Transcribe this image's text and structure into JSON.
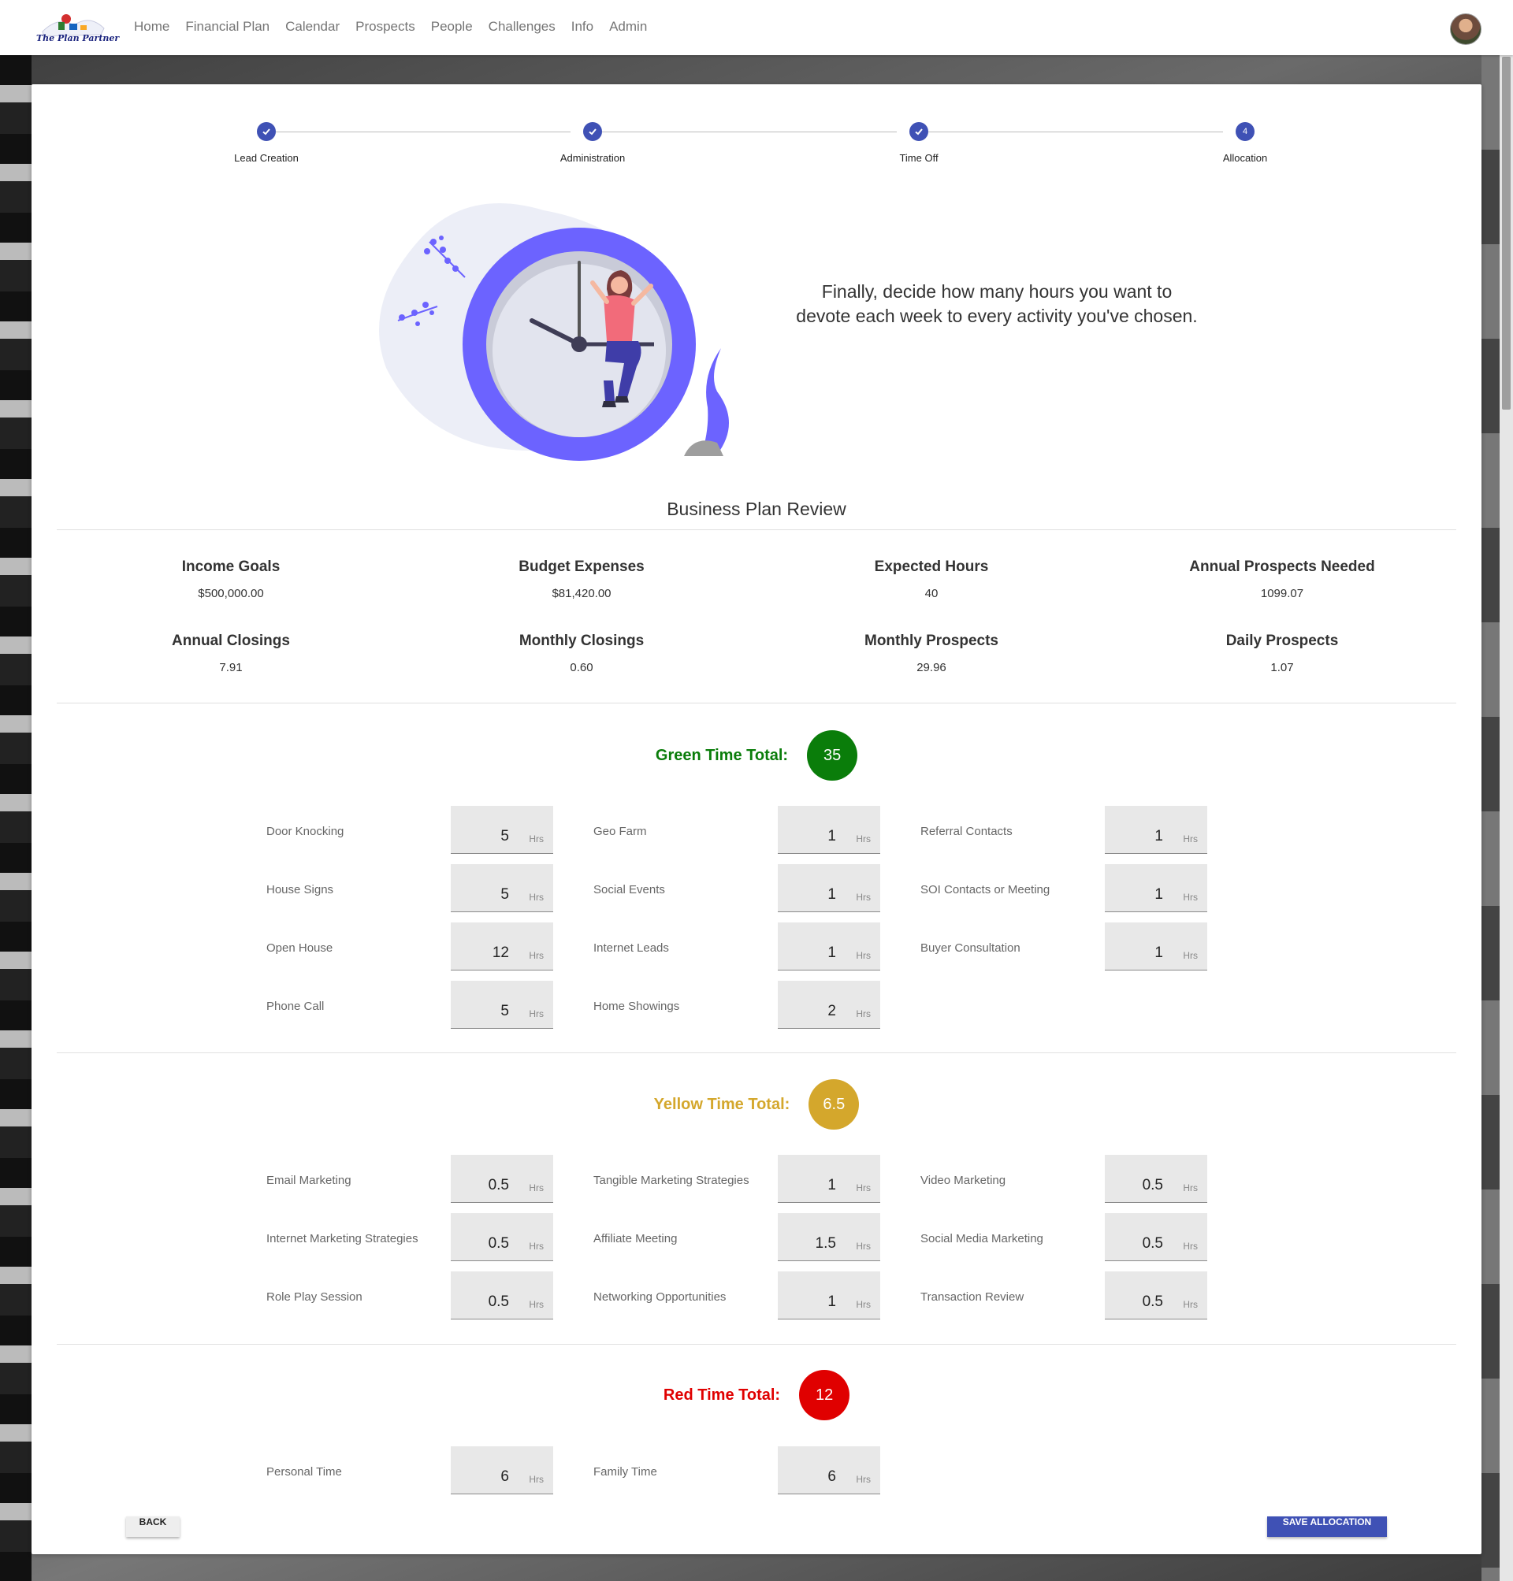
{
  "app": {
    "logo_text": "The Plan Partner",
    "nav": [
      "Home",
      "Financial Plan",
      "Calendar",
      "Prospects",
      "People",
      "Challenges",
      "Info",
      "Admin"
    ]
  },
  "stepper": {
    "steps": [
      {
        "label": "Lead Creation",
        "state": "done"
      },
      {
        "label": "Administration",
        "state": "done"
      },
      {
        "label": "Time Off",
        "state": "done"
      },
      {
        "label": "Allocation",
        "state": "active",
        "number": "4"
      }
    ]
  },
  "hero": {
    "line1": "Finally, decide how many hours you want to",
    "line2": "devote each week to every activity you've chosen."
  },
  "review": {
    "title": "Business Plan Review",
    "stats": [
      {
        "label": "Income Goals",
        "value": "$500,000.00"
      },
      {
        "label": "Budget Expenses",
        "value": "$81,420.00"
      },
      {
        "label": "Expected Hours",
        "value": "40"
      },
      {
        "label": "Annual Prospects Needed",
        "value": "1099.07"
      },
      {
        "label": "Annual Closings",
        "value": "7.91"
      },
      {
        "label": "Monthly Closings",
        "value": "0.60"
      },
      {
        "label": "Monthly Prospects",
        "value": "29.96"
      },
      {
        "label": "Daily Prospects",
        "value": "1.07"
      }
    ]
  },
  "unit": "Hrs",
  "green": {
    "title": "Green Time Total:",
    "total": "35",
    "color": "#0a7d0a",
    "items": [
      {
        "label": "Door Knocking",
        "value": "5"
      },
      {
        "label": "Geo Farm",
        "value": "1"
      },
      {
        "label": "Referral Contacts",
        "value": "1"
      },
      {
        "label": "House Signs",
        "value": "5"
      },
      {
        "label": "Social Events",
        "value": "1"
      },
      {
        "label": "SOI Contacts or Meeting",
        "value": "1"
      },
      {
        "label": "Open House",
        "value": "12"
      },
      {
        "label": "Internet Leads",
        "value": "1"
      },
      {
        "label": "Buyer Consultation",
        "value": "1"
      },
      {
        "label": "Phone Call",
        "value": "5"
      },
      {
        "label": "Home Showings",
        "value": "2"
      }
    ]
  },
  "yellow": {
    "title": "Yellow Time Total:",
    "total": "6.5",
    "color": "#d4a72c",
    "items": [
      {
        "label": "Email Marketing",
        "value": "0.5"
      },
      {
        "label": "Tangible Marketing Strategies",
        "value": "1"
      },
      {
        "label": "Video Marketing",
        "value": "0.5"
      },
      {
        "label": "Internet Marketing Strategies",
        "value": "0.5"
      },
      {
        "label": "Affiliate Meeting",
        "value": "1.5"
      },
      {
        "label": "Social Media Marketing",
        "value": "0.5"
      },
      {
        "label": "Role Play Session",
        "value": "0.5"
      },
      {
        "label": "Networking Opportunities",
        "value": "1"
      },
      {
        "label": "Transaction Review",
        "value": "0.5"
      }
    ]
  },
  "red": {
    "title": "Red Time Total:",
    "total": "12",
    "color": "#e00000",
    "items": [
      {
        "label": "Personal Time",
        "value": "6"
      },
      {
        "label": "Family Time",
        "value": "6"
      }
    ]
  },
  "buttons": {
    "back": "BACK",
    "save": "SAVE ALLOCATION"
  },
  "colors": {
    "primary": "#3f51b5"
  }
}
